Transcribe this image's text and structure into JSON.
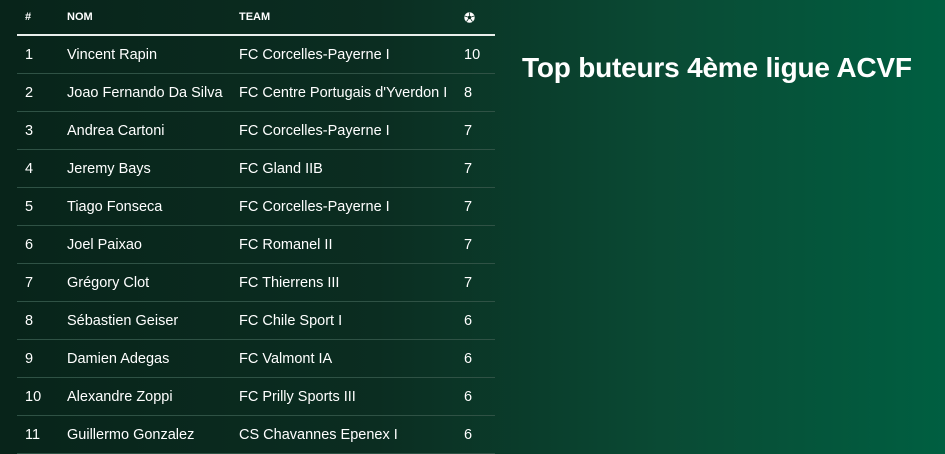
{
  "title": "Top buteurs 4ème ligue ACVF",
  "table": {
    "headers": {
      "rank": "#",
      "name": "NOM",
      "team": "TEAM",
      "goals_icon": "soccer-ball-icon"
    },
    "rows": [
      {
        "rank": "1",
        "name": "Vincent Rapin",
        "team": "FC Corcelles-Payerne I",
        "goals": "10"
      },
      {
        "rank": "2",
        "name": "Joao Fernando Da Silva",
        "team": "FC Centre Portugais d'Yverdon I",
        "goals": "8"
      },
      {
        "rank": "3",
        "name": "Andrea Cartoni",
        "team": "FC Corcelles-Payerne I",
        "goals": "7"
      },
      {
        "rank": "4",
        "name": "Jeremy Bays",
        "team": "FC Gland IIB",
        "goals": "7"
      },
      {
        "rank": "5",
        "name": "Tiago Fonseca",
        "team": "FC Corcelles-Payerne I",
        "goals": "7"
      },
      {
        "rank": "6",
        "name": "Joel Paixao",
        "team": "FC Romanel II",
        "goals": "7"
      },
      {
        "rank": "7",
        "name": "Grégory Clot",
        "team": "FC Thierrens III",
        "goals": "7"
      },
      {
        "rank": "8",
        "name": "Sébastien Geiser",
        "team": "FC Chile Sport I",
        "goals": "6"
      },
      {
        "rank": "9",
        "name": "Damien Adegas",
        "team": "FC Valmont IA",
        "goals": "6"
      },
      {
        "rank": "10",
        "name": "Alexandre Zoppi",
        "team": "FC Prilly Sports III",
        "goals": "6"
      },
      {
        "rank": "11",
        "name": "Guillermo Gonzalez",
        "team": "CS Chavannes Epenex I",
        "goals": "6"
      }
    ]
  },
  "colors": {
    "background_start": "#08241a",
    "background_end": "#005f41",
    "text": "#ffffff",
    "row_divider": "#2f5245"
  }
}
